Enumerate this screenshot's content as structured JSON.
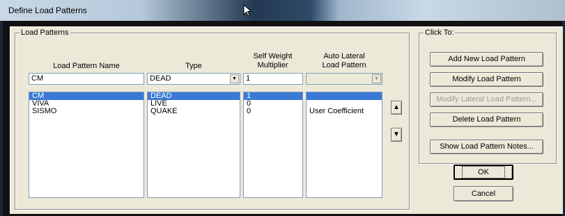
{
  "window": {
    "title": "Define Load Patterns"
  },
  "load_patterns": {
    "group_label": "Load Patterns",
    "headers": {
      "name": "Load Pattern Name",
      "type": "Type",
      "multiplier_line1": "Self Weight",
      "multiplier_line2": "Multiplier",
      "lateral_line1": "Auto Lateral",
      "lateral_line2": "Load Pattern"
    },
    "edit": {
      "name": "CM",
      "type": "DEAD",
      "multiplier": "1",
      "lateral": ""
    },
    "rows": [
      {
        "name": "CM",
        "type": "DEAD",
        "multiplier": "1",
        "lateral": ""
      },
      {
        "name": "VIVA",
        "type": "LIVE",
        "multiplier": "0",
        "lateral": ""
      },
      {
        "name": "SISMO",
        "type": "QUAKE",
        "multiplier": "0",
        "lateral": "User Coefficient"
      }
    ],
    "selected_row": 0
  },
  "click_to": {
    "group_label": "Click To:",
    "add": "Add New Load Pattern",
    "modify": "Modify Load Pattern",
    "modify_lateral": "Modify Lateral Load Pattern...",
    "delete": "Delete Load Pattern",
    "notes": "Show Load Pattern Notes..."
  },
  "buttons": {
    "ok": "OK",
    "cancel": "Cancel"
  },
  "icons": {
    "move_up": "arrow-up-icon",
    "move_down": "arrow-down-icon",
    "dropdown": "chevron-down-icon",
    "cursor": "mouse-pointer-icon"
  }
}
